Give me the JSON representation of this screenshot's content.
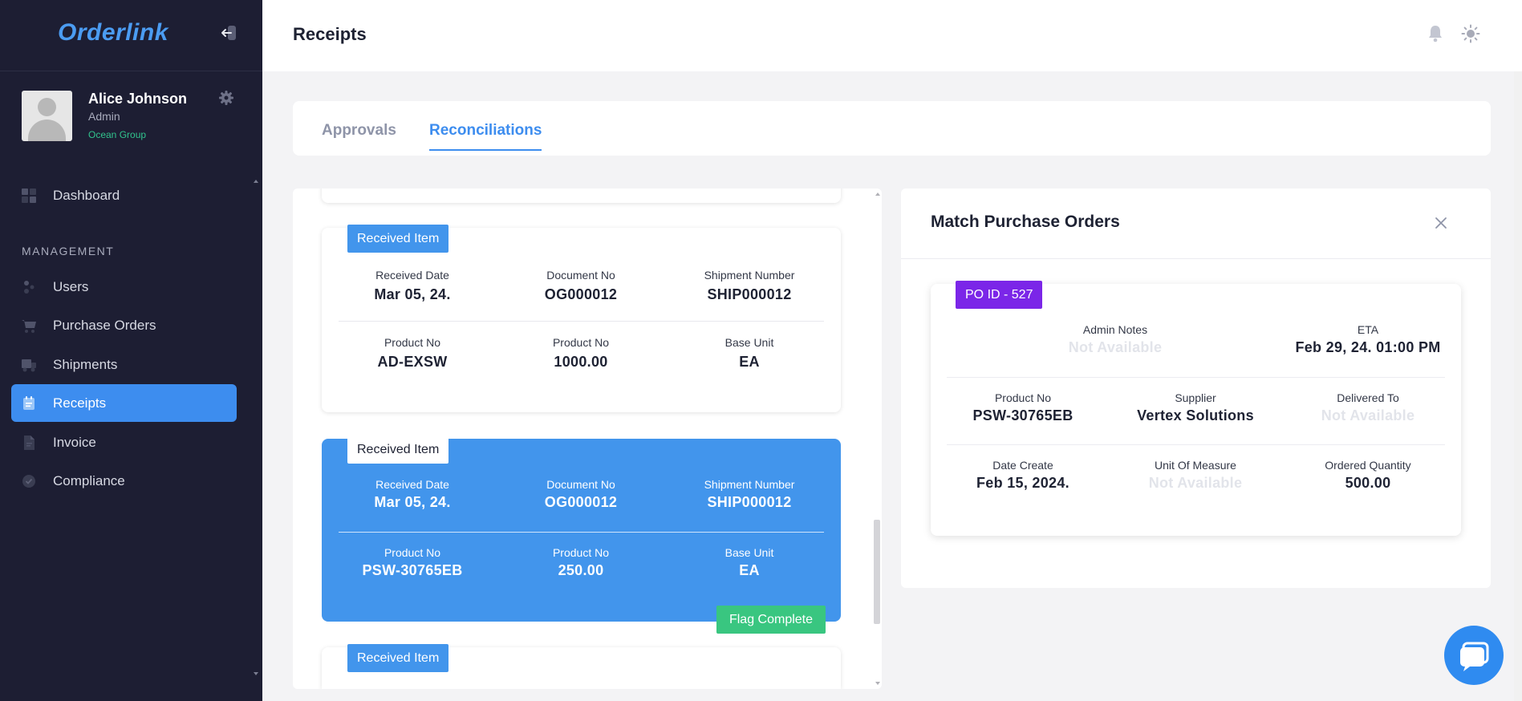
{
  "app": {
    "name": "Orderlink"
  },
  "user": {
    "name": "Alice Johnson",
    "role": "Admin",
    "organization": "Ocean Group"
  },
  "sidebar": {
    "section_label": "MANAGEMENT",
    "items": [
      {
        "label": "Dashboard",
        "icon": "dashboard-icon",
        "active": false
      },
      {
        "label": "Users",
        "icon": "users-icon",
        "active": false
      },
      {
        "label": "Purchase Orders",
        "icon": "cart-icon",
        "active": false
      },
      {
        "label": "Shipments",
        "icon": "truck-icon",
        "active": false
      },
      {
        "label": "Receipts",
        "icon": "receipt-icon",
        "active": true
      },
      {
        "label": "Invoice",
        "icon": "invoice-icon",
        "active": false
      },
      {
        "label": "Compliance",
        "icon": "check-circle-icon",
        "active": false
      }
    ]
  },
  "header": {
    "title": "Receipts",
    "icons": [
      "bell-icon",
      "theme-toggle-icon"
    ]
  },
  "tabs": [
    {
      "label": "Approvals",
      "active": false
    },
    {
      "label": "Reconciliations",
      "active": true
    }
  ],
  "received_items": [
    {
      "tag": "Received Item",
      "selected": false,
      "received_date_label": "Received Date",
      "received_date": "Mar 05, 24.",
      "document_no_label": "Document No",
      "document_no": "OG000012",
      "shipment_number_label": "Shipment Number",
      "shipment_number": "SHIP000012",
      "product_no_label": "Product No",
      "product_no": "AD-EXSW",
      "quantity_label": "Product No",
      "quantity": "1000.00",
      "base_unit_label": "Base Unit",
      "base_unit": "EA"
    },
    {
      "tag": "Received Item",
      "selected": true,
      "received_date_label": "Received Date",
      "received_date": "Mar 05, 24.",
      "document_no_label": "Document No",
      "document_no": "OG000012",
      "shipment_number_label": "Shipment Number",
      "shipment_number": "SHIP000012",
      "product_no_label": "Product No",
      "product_no": "PSW-30765EB",
      "quantity_label": "Product No",
      "quantity": "250.00",
      "base_unit_label": "Base Unit",
      "base_unit": "EA",
      "action_label": "Flag Complete"
    },
    {
      "tag": "Received Item",
      "selected": false
    }
  ],
  "match_panel": {
    "title": "Match Purchase Orders",
    "po": {
      "tag": "PO ID - 527",
      "admin_notes_label": "Admin Notes",
      "admin_notes": "Not Available",
      "eta_label": "ETA",
      "eta": "Feb 29, 24. 01:00 PM",
      "product_no_label": "Product No",
      "product_no": "PSW-30765EB",
      "supplier_label": "Supplier",
      "supplier": "Vertex Solutions",
      "delivered_to_label": "Delivered To",
      "delivered_to": "Not Available",
      "date_create_label": "Date Create",
      "date_create": "Feb 15, 2024.",
      "unit_of_measure_label": "Unit Of Measure",
      "unit_of_measure": "Not Available",
      "ordered_quantity_label": "Ordered Quantity",
      "ordered_quantity": "500.00"
    }
  },
  "colors": {
    "sidebar_bg": "#1d1e33",
    "accent": "#3d8def",
    "selected_card": "#4295ec",
    "success": "#39c680",
    "po_tag": "#7b26e8",
    "org_text": "#31c48d"
  }
}
